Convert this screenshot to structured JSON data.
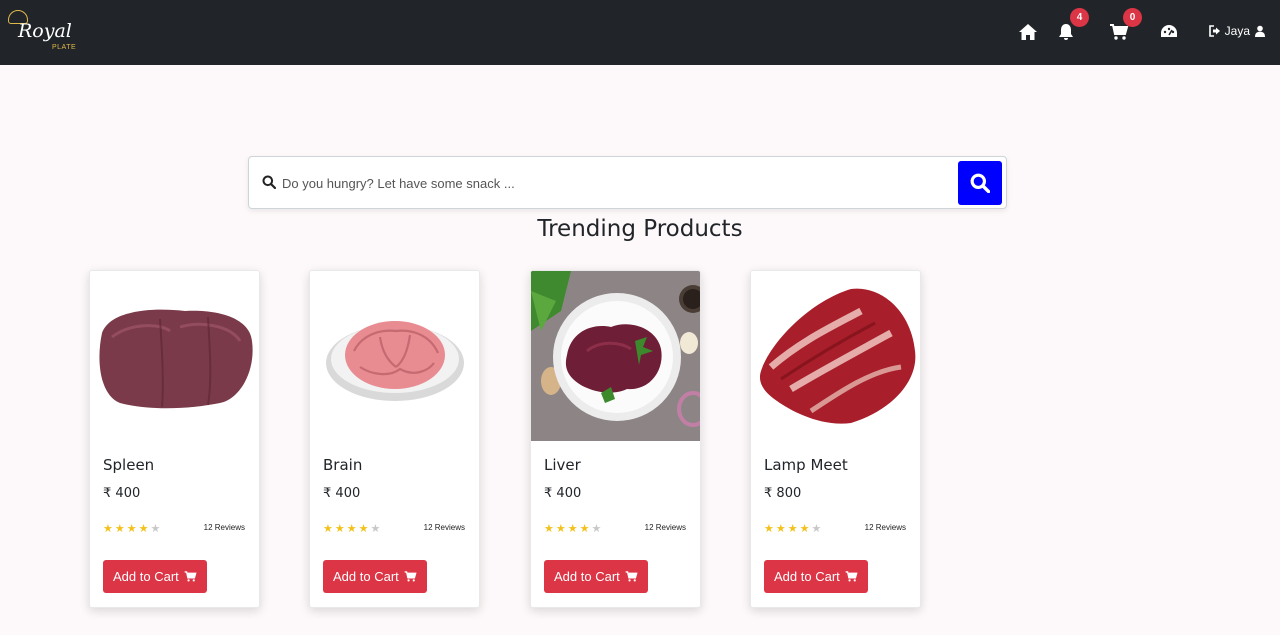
{
  "brand": {
    "logo_text": "Royal",
    "logo_sub": "PLATE"
  },
  "nav": {
    "notification_count": "4",
    "cart_count": "0",
    "user_name": "Jaya"
  },
  "search": {
    "placeholder": "Do you hungry? Let have some snack ..."
  },
  "section_title": "Trending Products",
  "products": [
    {
      "name": "Spleen",
      "price": "400",
      "currency": "₹",
      "rating": 4,
      "rating_max": 5,
      "reviews": "12 Reviews",
      "button": "Add to Cart"
    },
    {
      "name": "Brain",
      "price": "400",
      "currency": "₹",
      "rating": 4,
      "rating_max": 5,
      "reviews": "12 Reviews",
      "button": "Add to Cart"
    },
    {
      "name": "Liver",
      "price": "400",
      "currency": "₹",
      "rating": 4,
      "rating_max": 5,
      "reviews": "12 Reviews",
      "button": "Add to Cart"
    },
    {
      "name": "Lamp Meet",
      "price": "800",
      "currency": "₹",
      "rating": 4,
      "rating_max": 5,
      "reviews": "12 Reviews",
      "button": "Add to Cart"
    }
  ],
  "colors": {
    "navbar": "#212529",
    "badge": "#dc3545",
    "search_button": "#0000ff",
    "add_to_cart": "#dc3545",
    "star_on": "#f2c21b",
    "star_off": "#c8c8c8"
  },
  "icons": [
    "home-icon",
    "bell-icon",
    "cart-icon",
    "dashboard-icon",
    "sign-out-icon",
    "user-icon",
    "search-icon"
  ]
}
